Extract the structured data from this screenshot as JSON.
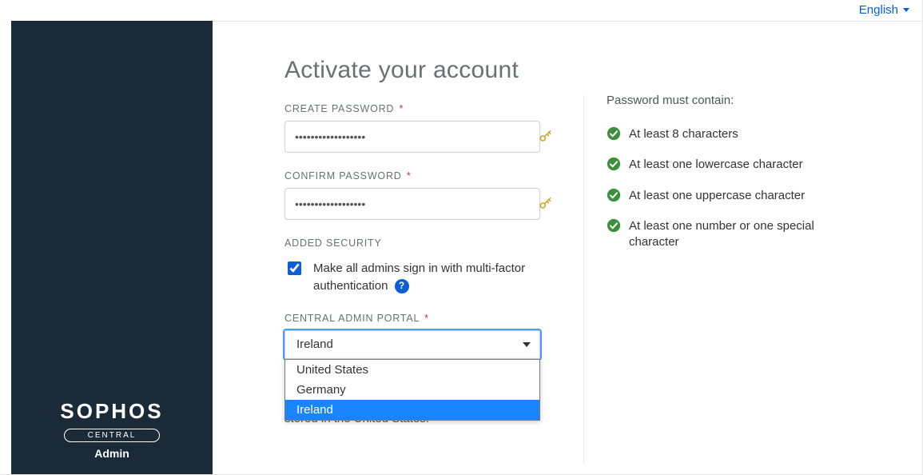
{
  "language": {
    "label": "English"
  },
  "brand": {
    "wordmark": "SOPHOS",
    "tier": "CENTRAL",
    "role": "Admin"
  },
  "page": {
    "title": "Activate your account",
    "labels": {
      "create_password": "CREATE PASSWORD",
      "confirm_password": "CONFIRM PASSWORD",
      "added_security": "ADDED SECURITY",
      "portal": "CENTRAL ADMIN PORTAL",
      "required_mark": "*"
    },
    "values": {
      "password": "••••••••••••••••••",
      "confirm": "••••••••••••••••••"
    },
    "mfa": {
      "checked": true,
      "label": "Make all admins sign in with multi-factor authentication",
      "help_glyph": "?"
    },
    "portal": {
      "selected": "Ireland",
      "options": [
        "United States",
        "Germany",
        "Ireland"
      ]
    },
    "storage_note": "stored in the United States."
  },
  "requirements": {
    "title": "Password must contain:",
    "items": [
      "At least 8 characters",
      "At least one lowercase character",
      "At least one uppercase character",
      "At least one number or one special character"
    ]
  },
  "colors": {
    "accent": "#0a5ed7",
    "success": "#3c8f3c"
  }
}
